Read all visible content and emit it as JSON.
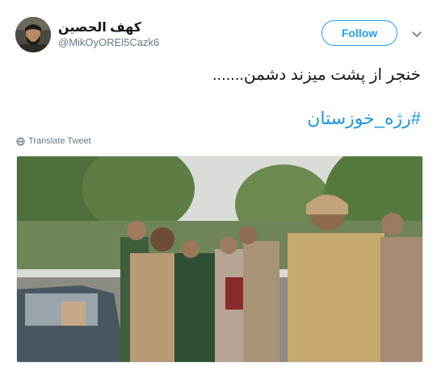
{
  "tweet": {
    "display_name": "کهف الحصین",
    "username": "@MikOyOREl5Cazk6",
    "follow_label": "Follow",
    "text": "خنجر از پشت میزند دشمن.......",
    "hashtag": "#رژه_خوزستان",
    "translate_label": "Translate Tweet"
  },
  "colors": {
    "accent": "#1da1f2",
    "hashtag": "#1b95e0",
    "secondary_text": "#657786"
  },
  "icons": {
    "menu": "chevron-down-icon",
    "translate": "globe-icon"
  }
}
